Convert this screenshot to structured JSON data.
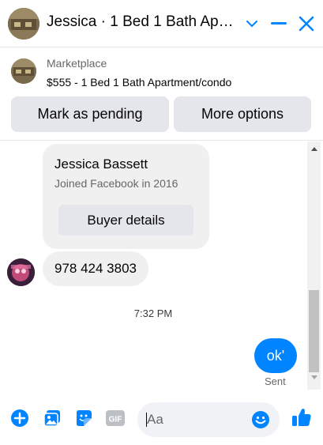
{
  "header": {
    "title": "Jessica · 1 Bed 1 Bath Apartment/condo",
    "icons": [
      "chevron-down-icon",
      "minimize-icon",
      "close-icon"
    ]
  },
  "marketplace": {
    "label": "Marketplace",
    "listing": "$555 - 1 Bed 1 Bath Apartment/condo",
    "buttons": {
      "pending": "Mark as pending",
      "more": "More options"
    }
  },
  "chat": {
    "buyer_card": {
      "name": "Jessica Bassett",
      "joined": "Joined Facebook in 2016",
      "button": "Buyer details"
    },
    "incoming_message": "978 424 3803",
    "timestamp": "7:32 PM",
    "outgoing_message": "ok'",
    "status": "Sent"
  },
  "composer": {
    "placeholder": "Aa",
    "icons": [
      "plus-icon",
      "photo-icon",
      "sticker-icon",
      "gif-icon",
      "emoji-icon",
      "thumbs-up-icon"
    ]
  },
  "colors": {
    "accent": "#0084ff",
    "bubble_gray": "#f0f0f0",
    "button_gray": "#e4e6eb"
  }
}
